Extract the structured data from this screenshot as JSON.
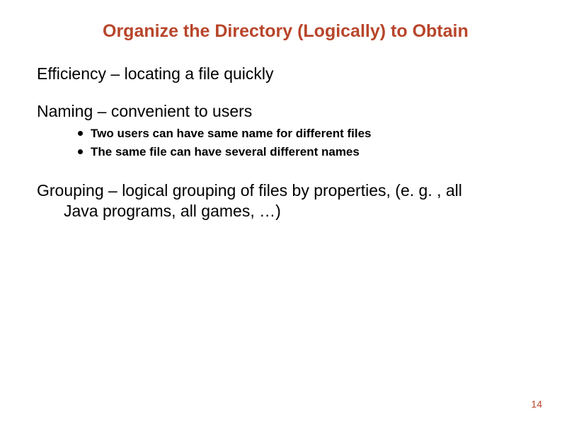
{
  "title": "Organize the Directory (Logically) to Obtain",
  "points": {
    "efficiency": "Efficiency – locating a file quickly",
    "naming": "Naming – convenient to users",
    "naming_sub": [
      "Two users can have same name for different files",
      "The same file can have several different names"
    ],
    "grouping_line1": "Grouping – logical grouping of files by properties, (e. g. , all",
    "grouping_line2": "Java programs, all games, …)"
  },
  "page_number": "14"
}
